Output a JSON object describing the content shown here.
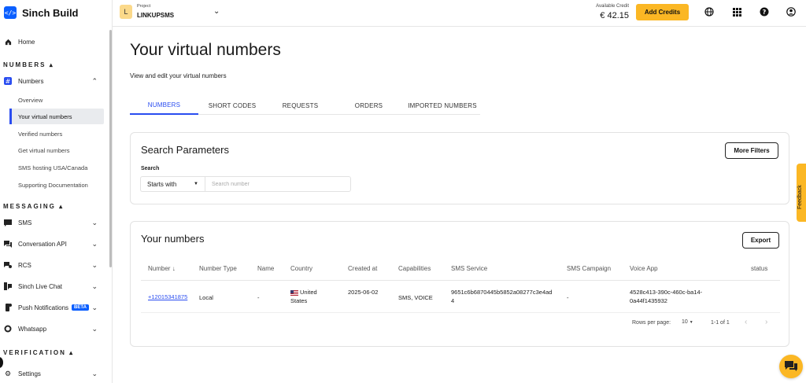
{
  "brand": {
    "name": "Sinch Build",
    "logo_glyph": "</>"
  },
  "topbar": {
    "project_caption": "Project",
    "project_initial": "L",
    "project_name": "LINKUPSMS",
    "credit_caption": "Available Credit",
    "credit_value": "€ 42.15",
    "add_credits_label": "Add Credits",
    "icons": [
      "globe-icon",
      "apps-grid-icon",
      "help-icon",
      "account-icon"
    ]
  },
  "sidebar": {
    "home": "Home",
    "numbers_section": "NUMBERS",
    "numbers_group": "Numbers",
    "numbers_items": [
      "Overview",
      "Your virtual numbers",
      "Verified numbers",
      "Get virtual numbers",
      "SMS hosting USA/Canada",
      "Supporting Documentation"
    ],
    "messaging_section": "MESSAGING",
    "messaging_items": [
      "SMS",
      "Conversation API",
      "RCS",
      "Sinch Live Chat",
      "Push Notifications",
      "Whatsapp"
    ],
    "beta_badge": "BETA",
    "verification_section": "VERIFICATION",
    "settings": "Settings"
  },
  "main": {
    "title": "Your virtual numbers",
    "subtitle": "View and edit your virtual numbers",
    "tabs": [
      "NUMBERS",
      "SHORT CODES",
      "REQUESTS",
      "ORDERS",
      "IMPORTED NUMBERS"
    ],
    "active_tab": "NUMBERS"
  },
  "search": {
    "title": "Search Parameters",
    "more_filters": "More Filters",
    "label": "Search",
    "mode": "Starts with",
    "placeholder": "Search number"
  },
  "numbers_table": {
    "title": "Your numbers",
    "export": "Export",
    "columns": [
      "Number",
      "Number Type",
      "Name",
      "Country",
      "Created at",
      "Capabilities",
      "SMS Service",
      "SMS Campaign",
      "Voice App",
      "status"
    ],
    "rows": [
      {
        "number": "+12015341875",
        "type": "Local",
        "name": "-",
        "country": "United States",
        "created_at": "2025-06-02",
        "capabilities": "SMS, VOICE",
        "sms_service": "9651c6b6870445b5852a08277c3e4ad4",
        "sms_campaign": "-",
        "voice_app": "4528c413-390c-460c-ba14-0a44f1435932",
        "status": ""
      }
    ],
    "rows_per_page_label": "Rows per page:",
    "rows_per_page": "10",
    "range": "1-1 of 1"
  },
  "feedback_label": "Feedback"
}
